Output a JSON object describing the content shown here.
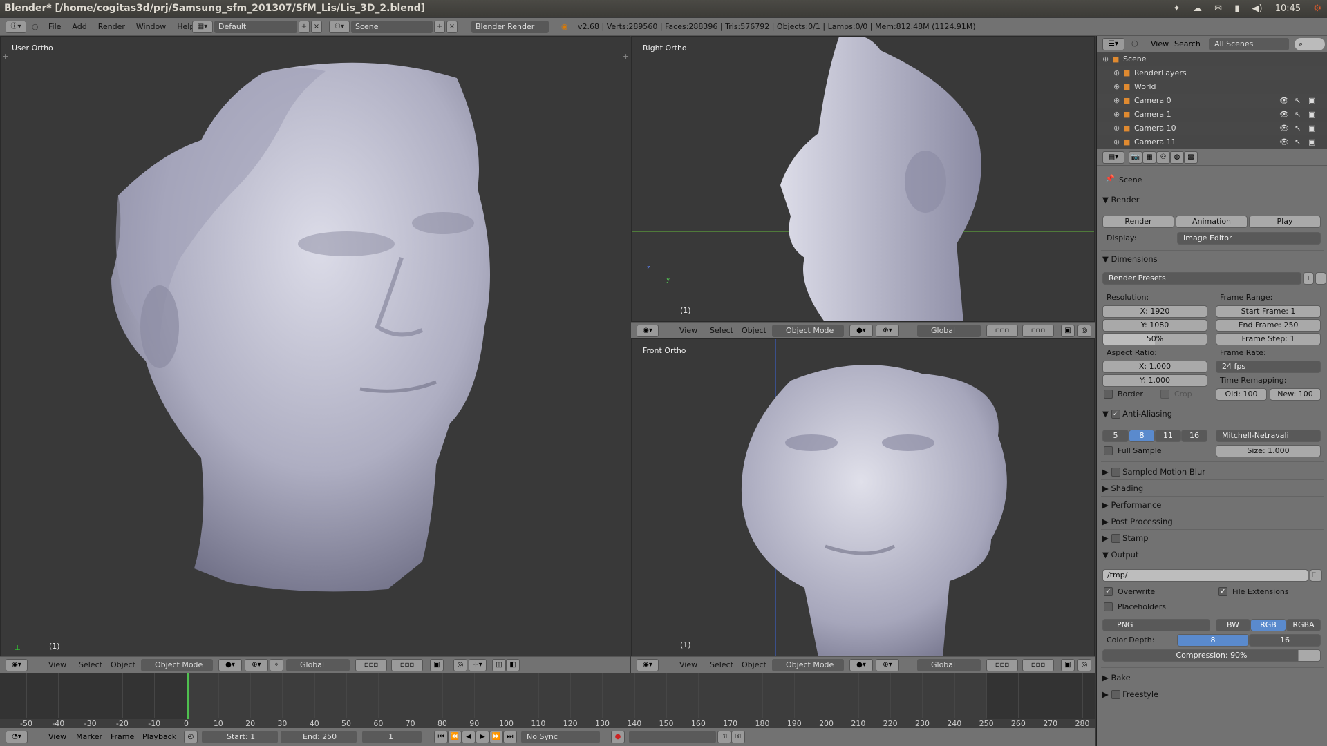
{
  "window_title": "Blender* [/home/cogitas3d/prj/Samsung_sfm_201307/SfM_Lis/Lis_3D_2.blend]",
  "tray": {
    "time": "10:45"
  },
  "info_header": {
    "menus": [
      "File",
      "Add",
      "Render",
      "Window",
      "Help"
    ],
    "layout": "Default",
    "scene": "Scene",
    "engine": "Blender Render",
    "stats": "v2.68 | Verts:289560 | Faces:288396 | Tris:576792 | Objects:0/1 | Lamps:0/0 | Mem:812.48M (1124.91M)"
  },
  "viewports": {
    "left": {
      "label": "User Ortho",
      "frame": "(1)"
    },
    "top_right": {
      "label": "Right Ortho",
      "frame": "(1)",
      "axis_z": "z",
      "axis_y": "y"
    },
    "bottom_right": {
      "label": "Front Ortho",
      "frame": "(1)"
    },
    "header": {
      "view": "View",
      "select": "Select",
      "object": "Object",
      "mode": "Object Mode",
      "orientation": "Global"
    }
  },
  "timeline": {
    "ticks": [
      "-50",
      "-40",
      "-30",
      "-20",
      "-10",
      "0",
      "10",
      "20",
      "30",
      "40",
      "50",
      "60",
      "70",
      "80",
      "90",
      "100",
      "110",
      "120",
      "130",
      "140",
      "150",
      "160",
      "170",
      "180",
      "190",
      "200",
      "210",
      "220",
      "230",
      "240",
      "250",
      "260",
      "270",
      "280"
    ],
    "current_frame": 1,
    "menus": [
      "View",
      "Marker",
      "Frame",
      "Playback"
    ],
    "start": "Start: 1",
    "end": "End: 250",
    "frame": "1",
    "sync": "No Sync"
  },
  "outliner": {
    "menus": [
      "View",
      "Search"
    ],
    "filter": "All Scenes",
    "rows": [
      {
        "label": "Scene",
        "indent": 0
      },
      {
        "label": "RenderLayers",
        "indent": 1
      },
      {
        "label": "World",
        "indent": 1
      },
      {
        "label": "Camera 0",
        "indent": 1
      },
      {
        "label": "Camera 1",
        "indent": 1
      },
      {
        "label": "Camera 10",
        "indent": 1
      },
      {
        "label": "Camera 11",
        "indent": 1
      }
    ]
  },
  "properties": {
    "context": "Scene",
    "render": {
      "title": "Render",
      "render_btn": "Render",
      "animation_btn": "Animation",
      "play_btn": "Play",
      "display_label": "Display:",
      "display": "Image Editor"
    },
    "dimensions": {
      "title": "Dimensions",
      "presets": "Render Presets",
      "resolution_label": "Resolution:",
      "res_x": "X: 1920",
      "res_y": "Y: 1080",
      "percent": "50%",
      "frame_range_label": "Frame Range:",
      "start_frame": "Start Frame: 1",
      "end_frame": "End Frame: 250",
      "frame_step": "Frame Step: 1",
      "aspect_label": "Aspect Ratio:",
      "aspect_x": "X: 1.000",
      "aspect_y": "Y: 1.000",
      "frame_rate_label": "Frame Rate:",
      "fps": "24 fps",
      "border": "Border",
      "crop": "Crop",
      "time_remap_label": "Time Remapping:",
      "old": "Old: 100",
      "new": "New: 100"
    },
    "anti_aliasing": {
      "title": "Anti-Aliasing",
      "samples": [
        "5",
        "8",
        "11",
        "16"
      ],
      "selected": "8",
      "filter": "Mitchell-Netravali",
      "full_sample": "Full Sample",
      "size": "Size: 1.000"
    },
    "collapsed": [
      "Sampled Motion Blur",
      "Shading",
      "Performance",
      "Post Processing",
      "Stamp"
    ],
    "output": {
      "title": "Output",
      "path": "/tmp/",
      "overwrite": "Overwrite",
      "file_ext": "File Extensions",
      "placeholders": "Placeholders",
      "format": "PNG",
      "bw": "BW",
      "rgb": "RGB",
      "rgba": "RGBA",
      "depth_label": "Color Depth:",
      "depth8": "8",
      "depth16": "16",
      "compression": "Compression: 90%"
    },
    "bottom": [
      "Bake",
      "Freestyle"
    ]
  },
  "colors": {
    "header": "#727272",
    "viewport": "#393939",
    "selection": "#5a8acd",
    "mesh": "#b9b9c9"
  }
}
